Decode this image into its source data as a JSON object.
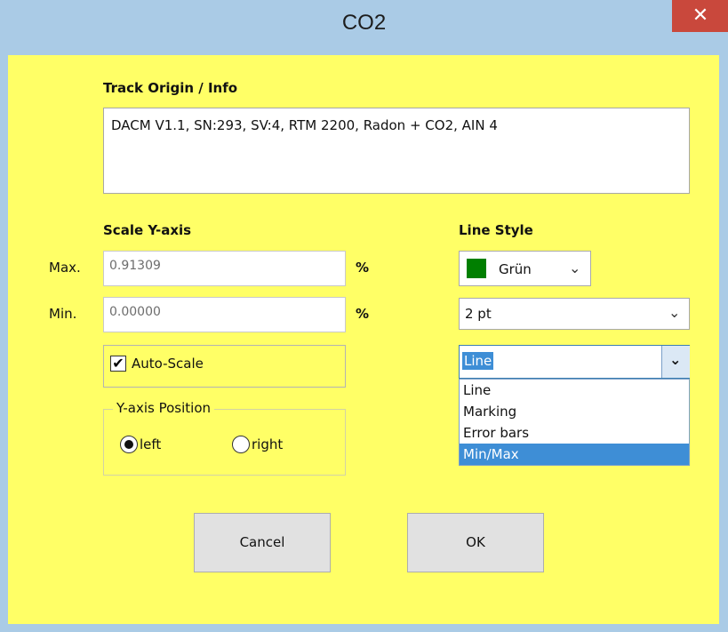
{
  "window": {
    "title": "CO2",
    "close_label": "✕"
  },
  "info": {
    "heading": "Track Origin / Info",
    "text": "DACM V1.1, SN:293, SV:4, RTM 2200, Radon + CO2, AIN 4"
  },
  "scale": {
    "heading": "Scale Y-axis",
    "max_label": "Max.",
    "max_value": "0.91309",
    "max_unit": "%",
    "min_label": "Min.",
    "min_value": "0.00000",
    "min_unit": "%",
    "autoscale_label": "Auto-Scale",
    "autoscale_checked": true,
    "checkmark": "✔"
  },
  "yaxis": {
    "group_title": "Y-axis Position",
    "left_label": "left",
    "right_label": "right",
    "selected": "left"
  },
  "linestyle": {
    "heading": "Line Style",
    "color_value": "Grün",
    "color_hex": "#007f00",
    "width_value": "2 pt",
    "type_value": "Line",
    "type_options": [
      "Line",
      "Marking",
      "Error bars",
      "Min/Max"
    ],
    "highlighted_option": "Min/Max"
  },
  "buttons": {
    "cancel": "Cancel",
    "ok": "OK"
  },
  "icons": {
    "dropdown": "chevron-down-icon",
    "close": "close-icon"
  }
}
